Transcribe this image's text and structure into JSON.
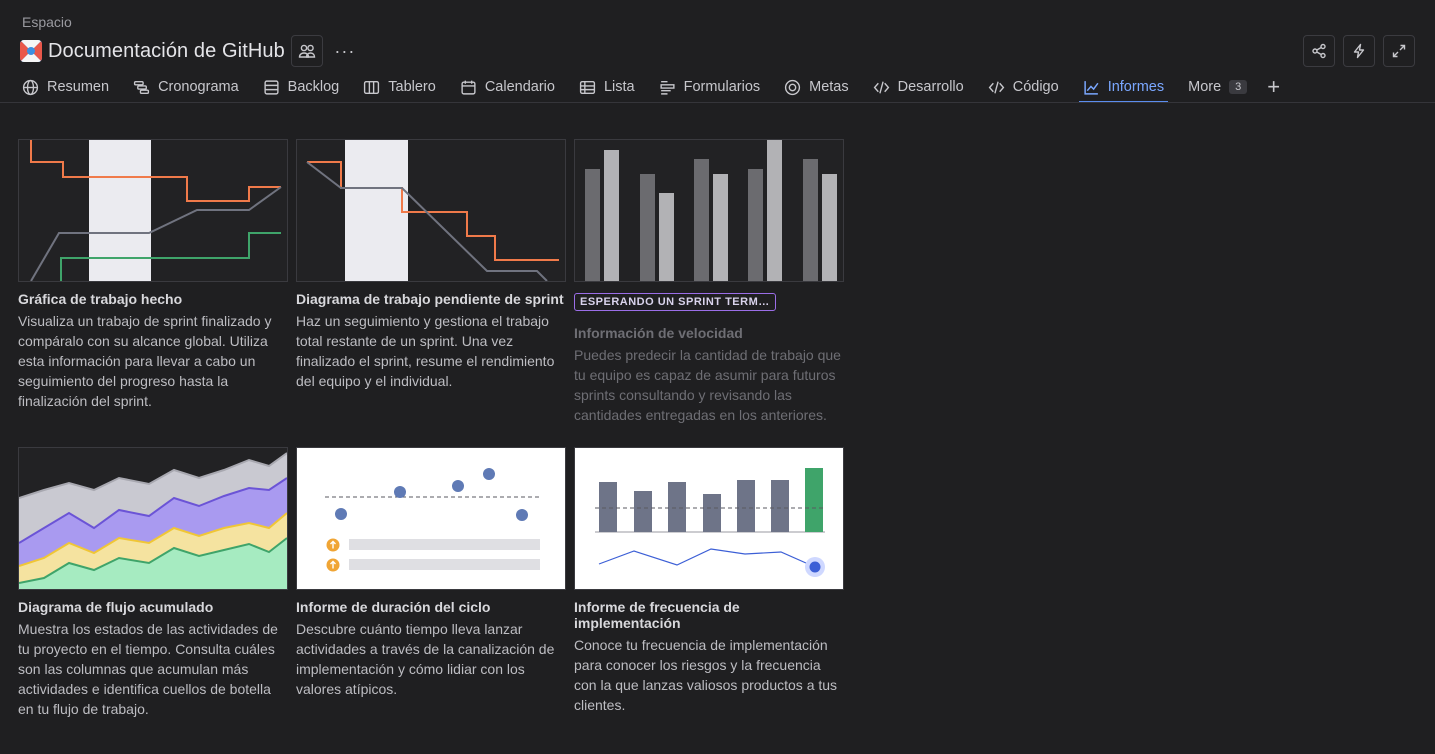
{
  "header": {
    "space_label": "Espacio",
    "title": "Documentación de GitHub",
    "more_label": "···"
  },
  "tabs": [
    {
      "label": "Resumen",
      "icon": "globe-icon"
    },
    {
      "label": "Cronograma",
      "icon": "timeline-icon"
    },
    {
      "label": "Backlog",
      "icon": "backlog-icon"
    },
    {
      "label": "Tablero",
      "icon": "board-icon"
    },
    {
      "label": "Calendario",
      "icon": "calendar-icon"
    },
    {
      "label": "Lista",
      "icon": "list-icon"
    },
    {
      "label": "Formularios",
      "icon": "forms-icon"
    },
    {
      "label": "Metas",
      "icon": "goals-icon"
    },
    {
      "label": "Desarrollo",
      "icon": "code-icon"
    },
    {
      "label": "Código",
      "icon": "code-icon"
    },
    {
      "label": "Informes",
      "icon": "chart-icon",
      "active": true
    },
    {
      "label": "More",
      "badge": "3"
    }
  ],
  "colors": {
    "accent": "#5b8def",
    "orange": "#f07a4a",
    "green": "#3fa46a",
    "purple_badge": "#9b6ee8"
  },
  "cards": [
    {
      "title": "Gráfica de trabajo hecho",
      "desc": "Visualiza un trabajo de sprint finalizado y compáralo con su alcance global. Utiliza esta información para llevar a cabo un seguimiento del progreso hasta la finalización del sprint."
    },
    {
      "title": "Diagrama de trabajo pendiente de sprint",
      "desc": "Haz un seguimiento y gestiona el trabajo total restante de un sprint. Una vez finalizado el sprint, resume el rendimiento del equipo y el individual."
    },
    {
      "badge": "ESPERANDO UN SPRINT TERMINADO",
      "title": "Información de velocidad",
      "desc": "Puedes predecir la cantidad de trabajo que tu equipo es capaz de asumir para futuros sprints consultando y revisando las cantidades entregadas en los anteriores."
    },
    {
      "title": "Diagrama de flujo acumulado",
      "desc": "Muestra los estados de las actividades de tu proyecto en el tiempo. Consulta cuáles son las columnas que acumulan más actividades e identifica cuellos de botella en tu flujo de trabajo."
    },
    {
      "title": "Informe de duración del ciclo",
      "desc": "Descubre cuánto tiempo lleva lanzar actividades a través de la canalización de implementación y cómo lidiar con los valores atípicos."
    },
    {
      "title": "Informe de frecuencia de implementación",
      "desc": "Conoce tu frecuencia de implementación para conocer los riesgos y la frecuencia con la que lanzas valiosos productos a tus clientes."
    }
  ]
}
